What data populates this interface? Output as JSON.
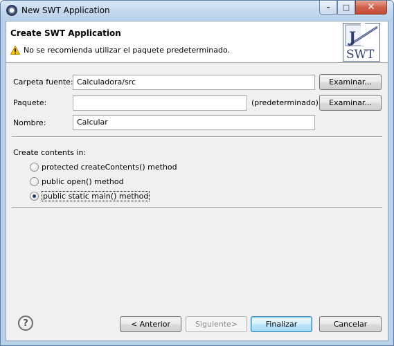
{
  "window": {
    "title": "New SWT Application",
    "controls": {
      "minimize": "–",
      "maximize": "□",
      "close": "✕"
    }
  },
  "header": {
    "title": "Create SWT Application",
    "message": "No se recomienda utilizar el paquete predeterminado.",
    "message_icon": "warning-icon",
    "logo": {
      "letter": "J",
      "text": "SWT"
    }
  },
  "form": {
    "source_folder": {
      "label": "Carpeta fuente:",
      "value": "Calculadora/src",
      "browse": "Examinar..."
    },
    "package": {
      "label": "Paquete:",
      "value": "",
      "suffix": "(predeterminado)",
      "browse": "Examinar..."
    },
    "name": {
      "label": "Nombre:",
      "value": "Calcular"
    }
  },
  "contents": {
    "heading": "Create contents in:",
    "options": [
      {
        "label": "protected createContents() method",
        "checked": false
      },
      {
        "label": "public open() method",
        "checked": false
      },
      {
        "label": "public static main() method",
        "checked": true
      }
    ]
  },
  "footer": {
    "help": "?",
    "back": "< Anterior",
    "next": "Siguiente>",
    "finish": "Finalizar",
    "cancel": "Cancelar"
  }
}
